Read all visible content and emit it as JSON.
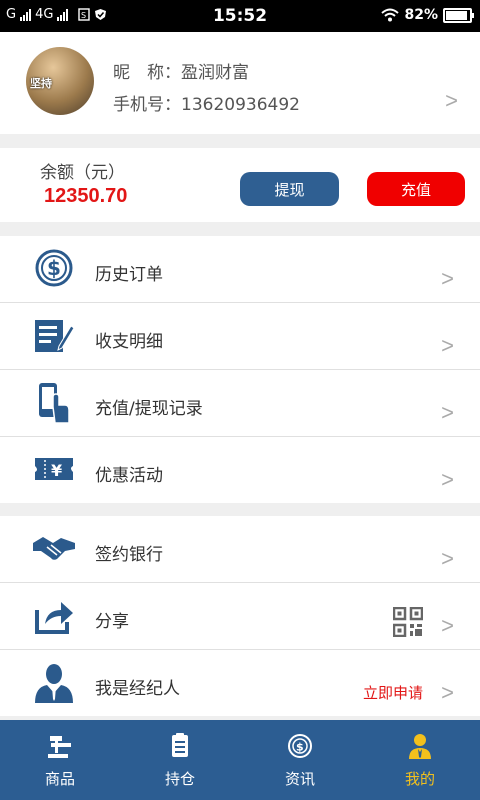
{
  "status_bar": {
    "carrier_left": "G",
    "network": "4G",
    "time": "15:52",
    "battery": "82%",
    "battery_level": 0.82
  },
  "profile": {
    "avatar_text": "坚持",
    "nickname_label": "昵　称：",
    "nickname": "盈润财富",
    "phone_label": "手机号：",
    "phone": "13620936492",
    "arrow": ">"
  },
  "balance": {
    "label": "余额（元）",
    "value": "12350.70",
    "withdraw_label": "提现",
    "recharge_label": "充值"
  },
  "menu_group_1": [
    {
      "label": "历史订单",
      "icon": "dollar-circle-icon"
    },
    {
      "label": "收支明细",
      "icon": "ledger-edit-icon"
    },
    {
      "label": "充值/提现记录",
      "icon": "phone-tap-icon"
    },
    {
      "label": "优惠活动",
      "icon": "coupon-yen-icon"
    }
  ],
  "menu_group_2": [
    {
      "label": "签约银行",
      "icon": "handshake-icon"
    },
    {
      "label": "分享",
      "icon": "share-icon",
      "extra_icon": "qrcode-icon"
    },
    {
      "label": "我是经纪人",
      "icon": "agent-person-icon",
      "extra_text": "立即申请"
    }
  ],
  "tabbar": {
    "tabs": [
      {
        "label": "商品",
        "icon": "gavel-icon"
      },
      {
        "label": "持仓",
        "icon": "clipboard-icon"
      },
      {
        "label": "资讯",
        "icon": "coin-globe-icon"
      },
      {
        "label": "我的",
        "icon": "user-icon",
        "active": true
      }
    ],
    "active_color": "#f2c01d"
  },
  "colors": {
    "brand_blue": "#2f5f92",
    "tabbar_blue": "#2c5d92",
    "accent_red": "#e21616",
    "icon_blue": "#2b5a8c"
  }
}
